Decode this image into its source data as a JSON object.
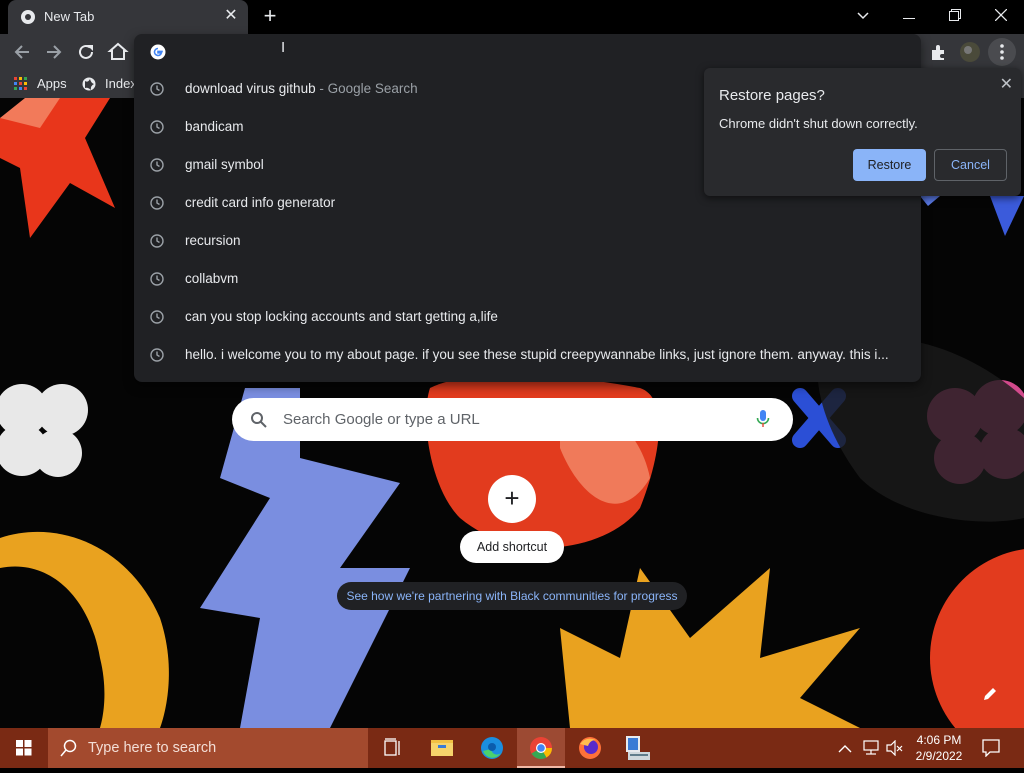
{
  "browser": {
    "tab_title": "New Tab",
    "new_tab_symbol": "+",
    "close_symbol": "✕"
  },
  "bookmarks": {
    "apps_label": "Apps",
    "index_label": "Index"
  },
  "omnibox": {
    "suggestions": [
      {
        "text": "download virus github",
        "sub": " - Google Search"
      },
      {
        "text": "bandicam",
        "sub": ""
      },
      {
        "text": "gmail symbol",
        "sub": ""
      },
      {
        "text": "credit card info generator",
        "sub": ""
      },
      {
        "text": "recursion",
        "sub": ""
      },
      {
        "text": "collabvm",
        "sub": ""
      },
      {
        "text": "can you stop locking accounts and start getting a,life",
        "sub": ""
      },
      {
        "text": "hello. i welcome you to my about page. if you see these stupid creepywannabe links, just ignore them. anyway. this i...",
        "sub": ""
      }
    ]
  },
  "restore_dialog": {
    "title": "Restore pages?",
    "message": "Chrome didn't shut down correctly.",
    "restore_label": "Restore",
    "cancel_label": "Cancel"
  },
  "ntp": {
    "search_placeholder": "Search Google or type a URL",
    "add_shortcut_label": "Add shortcut",
    "promo_text": "See how we're partnering with Black communities for progress"
  },
  "taskbar": {
    "search_placeholder": "Type here to search",
    "time": "4:06 PM",
    "date": "2/9/2022"
  },
  "colors": {
    "accent": "#8ab4f8",
    "taskbar": "#7a2a14"
  }
}
